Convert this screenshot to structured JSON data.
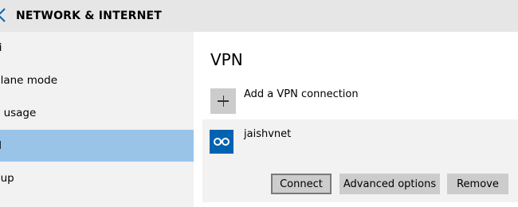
{
  "header": {
    "title": "NETWORK & INTERNET",
    "back_icon": "back-arrow-icon"
  },
  "sidebar": {
    "items": [
      {
        "label": "Fi",
        "selected": false
      },
      {
        "label": "plane mode",
        "selected": false
      },
      {
        "label": "a usage",
        "selected": false
      },
      {
        "label": "N",
        "selected": true
      },
      {
        "label": "l-up",
        "selected": false
      }
    ]
  },
  "main": {
    "section_title": "VPN",
    "add_connection_label": "Add a VPN connection",
    "connection": {
      "name": "jaishvnet",
      "icon": "vpn-connection-icon",
      "buttons": {
        "connect": "Connect",
        "advanced": "Advanced options",
        "remove": "Remove"
      }
    }
  },
  "colors": {
    "accent": "#0063b1",
    "selected_nav": "#99c4e8",
    "sidebar_bg": "#f2f2f2",
    "button_bg": "#cccccc"
  }
}
